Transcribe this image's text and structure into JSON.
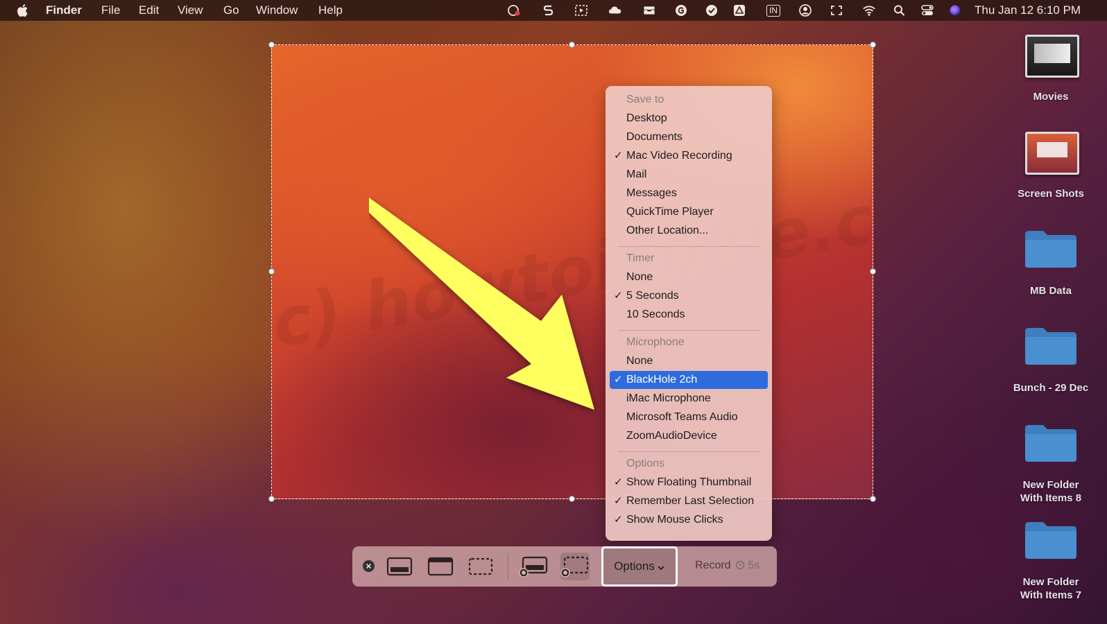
{
  "menubar": {
    "app_name": "Finder",
    "menus": [
      "File",
      "Edit",
      "View",
      "Go",
      "Window",
      "Help"
    ],
    "clock": "Thu Jan 12  6:10 PM",
    "status_icons": [
      "camera-record-icon",
      "s-app-icon",
      "screenshot-icon",
      "cloud-icon",
      "drawer-icon",
      "g-circle-icon",
      "checkmark-circle-icon",
      "drive-icon",
      "in-badge-icon",
      "user-circle-icon",
      "expand-icon",
      "wifi-icon",
      "search-icon",
      "control-center-icon",
      "siri-icon"
    ],
    "in_badge_text": "IN"
  },
  "watermark": "(c) howtoisolve.com",
  "dropdown": {
    "save_to_header": "Save to",
    "save_to": [
      {
        "label": "Desktop",
        "checked": false
      },
      {
        "label": "Documents",
        "checked": false
      },
      {
        "label": "Mac Video Recording",
        "checked": true
      },
      {
        "label": "Mail",
        "checked": false
      },
      {
        "label": "Messages",
        "checked": false
      },
      {
        "label": "QuickTime Player",
        "checked": false
      },
      {
        "label": "Other Location...",
        "checked": false
      }
    ],
    "timer_header": "Timer",
    "timer": [
      {
        "label": "None",
        "checked": false
      },
      {
        "label": "5 Seconds",
        "checked": true
      },
      {
        "label": "10 Seconds",
        "checked": false
      }
    ],
    "microphone_header": "Microphone",
    "microphone": [
      {
        "label": "None",
        "checked": false
      },
      {
        "label": "BlackHole 2ch",
        "checked": true,
        "highlighted": true
      },
      {
        "label": "iMac Microphone",
        "checked": false
      },
      {
        "label": "Microsoft Teams Audio",
        "checked": false
      },
      {
        "label": "ZoomAudioDevice",
        "checked": false
      }
    ],
    "options_header": "Options",
    "options": [
      {
        "label": "Show Floating Thumbnail",
        "checked": true
      },
      {
        "label": "Remember Last Selection",
        "checked": true
      },
      {
        "label": "Show Mouse Clicks",
        "checked": true
      }
    ],
    "check_glyph": "✓"
  },
  "toolbar": {
    "options_label": "Options",
    "record_label": "Record",
    "timer_label": "5s",
    "accent": "#2e6cde"
  },
  "desktop": [
    {
      "label": "Movies",
      "kind": "thumbnail"
    },
    {
      "label": "Screen Shots",
      "kind": "thumbnail"
    },
    {
      "label": "MB Data",
      "kind": "folder"
    },
    {
      "label": "Bunch - 29 Dec",
      "kind": "folder"
    },
    {
      "label": "New Folder With Items 8",
      "kind": "folder"
    },
    {
      "label": "New Folder With Items 7",
      "kind": "folder"
    }
  ]
}
